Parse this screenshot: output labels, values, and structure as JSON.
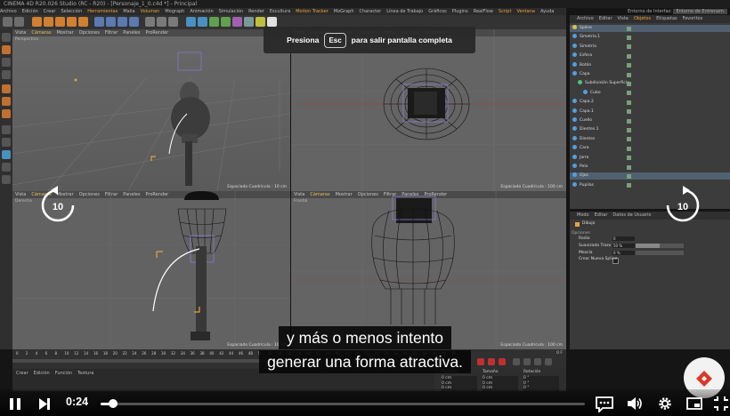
{
  "app": {
    "title": "CINEMA 4D R20.026 Studio (RC - R20) - [Personaje_1_0.c4d *] - Principal",
    "menu": [
      "Archivo",
      "Edición",
      "Crear",
      "Selección",
      "Herramientas",
      "Malla",
      "Volumen",
      "Mograph",
      "Animación",
      "Simulación",
      "Render",
      "Escultura",
      "Motion Tracker",
      "MoGraph",
      "Character",
      "Línea de Trabajo",
      "Gráficos",
      "Plugins",
      "RealFlow",
      "Script",
      "Ventana",
      "Ayuda"
    ],
    "menu_highlight": [
      "Herramientas",
      "Volumen",
      "Motion Tracker",
      "Script",
      "Ventana"
    ],
    "layout_label": "Entorno de Interfaz:",
    "layout_value": "Entorno de Entrenam."
  },
  "viewports": [
    {
      "menu": [
        "Vista",
        "Cámaras",
        "Mostrar",
        "Opciones",
        "Filtrar",
        "Paneles",
        "ProRender"
      ],
      "label": "Perspectiva",
      "footer": "Espaciado Cuadrícula : 10 cm"
    },
    {
      "menu": [
        "Vista",
        "Cámaras",
        "Mostrar",
        "Opciones",
        "Filtrar",
        "Paneles",
        "ProRender"
      ],
      "label": "Superior",
      "footer": "Espaciado Cuadrícula : 100 cm"
    },
    {
      "menu": [
        "Vista",
        "Cámaras",
        "Mostrar",
        "Opciones",
        "Filtrar",
        "Paneles",
        "ProRender"
      ],
      "label": "Derecha",
      "footer": "Espaciado Cuadrícula : 10 cm"
    },
    {
      "menu": [
        "Vista",
        "Cámaras",
        "Mostrar",
        "Opciones",
        "Filtrar",
        "Paneles",
        "ProRender"
      ],
      "label": "Frontal",
      "footer": "Espaciado Cuadrícula : 100 cm"
    }
  ],
  "objects": {
    "tabs": [
      "Archivo",
      "Editar",
      "Vista",
      "Objetos",
      "Etiquetas",
      "Favoritos"
    ],
    "active_tab": "Objetos",
    "items": [
      {
        "name": "Spline",
        "indent": 0,
        "color": "#e0c050",
        "selected": true
      },
      {
        "name": "Simetría.1",
        "indent": 0,
        "color": "#50a0e0"
      },
      {
        "name": "Simetría",
        "indent": 0,
        "color": "#50a0e0"
      },
      {
        "name": "Esfera",
        "indent": 0,
        "color": "#50a0e0"
      },
      {
        "name": "Botón",
        "indent": 0,
        "color": "#50a0e0"
      },
      {
        "name": "Capa",
        "indent": 0,
        "color": "#50a0e0"
      },
      {
        "name": "Subdivisión Superficie",
        "indent": 1,
        "color": "#50c080"
      },
      {
        "name": "Cubo",
        "indent": 2,
        "color": "#50a0e0"
      },
      {
        "name": "Capa.2",
        "indent": 0,
        "color": "#50a0e0"
      },
      {
        "name": "Capa.1",
        "indent": 0,
        "color": "#50a0e0"
      },
      {
        "name": "Cuello",
        "indent": 0,
        "color": "#50a0e0"
      },
      {
        "name": "Dientes.1",
        "indent": 0,
        "color": "#50a0e0"
      },
      {
        "name": "Dientes",
        "indent": 0,
        "color": "#50a0e0"
      },
      {
        "name": "Cara",
        "indent": 0,
        "color": "#50a0e0"
      },
      {
        "name": "Jarro",
        "indent": 0,
        "color": "#50a0e0"
      },
      {
        "name": "Pelo",
        "indent": 0,
        "color": "#50a0e0"
      },
      {
        "name": "Ojos",
        "indent": 0,
        "color": "#50a0e0",
        "selected": true
      },
      {
        "name": "Pupilas",
        "indent": 0,
        "color": "#50a0e0"
      }
    ]
  },
  "attributes": {
    "tabs": [
      "Modo",
      "Editar",
      "Datos de Usuario"
    ],
    "object": "Dibujo",
    "section": "Opciones",
    "fields": [
      {
        "label": "Radio",
        "value": "0"
      },
      {
        "label": "Suavizado Trazo",
        "value": "50 %",
        "level": 0.5
      },
      {
        "label": "Mezcla",
        "value": "0 %",
        "level": 0
      }
    ],
    "checkbox_label": "Crear Nueva Spline"
  },
  "timeline": {
    "ticks": [
      "0",
      "2",
      "4",
      "6",
      "8",
      "10",
      "12",
      "14",
      "16",
      "18",
      "20",
      "22",
      "24",
      "26",
      "28",
      "30",
      "32",
      "34",
      "36",
      "38",
      "40",
      "42",
      "44",
      "46",
      "48",
      "50",
      "52",
      "54",
      "56",
      "58",
      "60",
      "62",
      "64",
      "66",
      "68",
      "70",
      "72",
      "74",
      "76",
      "78",
      "80",
      "82",
      "84",
      "86",
      "88",
      "90"
    ],
    "end_label": "0 F"
  },
  "materials": {
    "menu": [
      "Crear",
      "Edición",
      "Función",
      "Textura"
    ]
  },
  "coordinates": {
    "headers": [
      "Posición",
      "Tamaño",
      "Rotación"
    ],
    "rows": [
      [
        "0 cm",
        "0 cm",
        "0 °"
      ],
      [
        "0 cm",
        "0 cm",
        "0 °"
      ],
      [
        "0 cm",
        "0 cm",
        "0 °"
      ]
    ]
  },
  "overlay": {
    "press_label": "Presiona",
    "key_label": "Esc",
    "rest_label": "para salir pantalla completa",
    "skip_back": "10",
    "skip_forward": "10"
  },
  "subtitles": [
    "y más o menos intento",
    "generar una forma atractiva."
  ],
  "player": {
    "time": "0:24",
    "progress": 0.025
  },
  "colors": {
    "accent": "#e8a33c",
    "logo_red": "#d83a2a"
  },
  "icons": [
    "pause-icon",
    "next-icon",
    "subtitles-icon",
    "volume-icon",
    "settings-icon",
    "pip-icon",
    "fullscreen-icon",
    "rewind-10-icon",
    "forward-10-icon"
  ]
}
